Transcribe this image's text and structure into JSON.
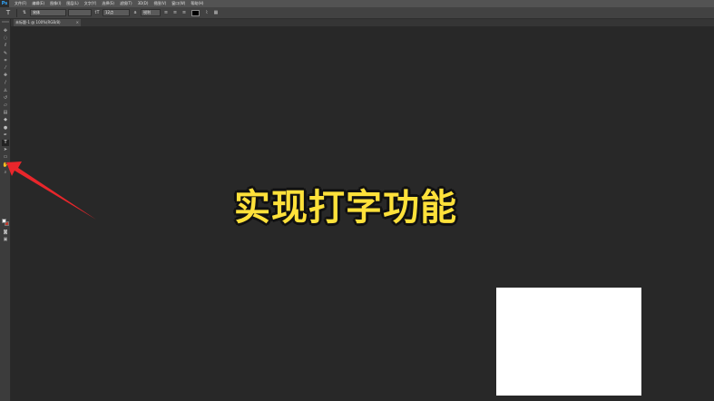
{
  "app": {
    "logo": "Ps"
  },
  "menu": [
    "文件(F)",
    "编辑(E)",
    "图像(I)",
    "图层(L)",
    "文字(Y)",
    "选择(S)",
    "滤镜(T)",
    "3D(D)",
    "视图(V)",
    "窗口(W)",
    "帮助(H)"
  ],
  "options": {
    "tool_glyph": "T",
    "font_family": "宋体",
    "font_size": "12点",
    "antialias": "锐利",
    "text_color": "#000000"
  },
  "document": {
    "tab_title": "未标题-1 @ 100%(RGB/8)",
    "close_glyph": "×"
  },
  "tools": [
    {
      "name": "move-tool",
      "glyph": "✥"
    },
    {
      "name": "marquee-tool",
      "glyph": "◌"
    },
    {
      "name": "lasso-tool",
      "glyph": "ℓ"
    },
    {
      "name": "quick-select-tool",
      "glyph": "✎"
    },
    {
      "name": "crop-tool",
      "glyph": "⌗"
    },
    {
      "name": "eyedropper-tool",
      "glyph": "⁄"
    },
    {
      "name": "healing-tool",
      "glyph": "✚"
    },
    {
      "name": "brush-tool",
      "glyph": "∕"
    },
    {
      "name": "stamp-tool",
      "glyph": "♙"
    },
    {
      "name": "history-brush-tool",
      "glyph": "↺"
    },
    {
      "name": "eraser-tool",
      "glyph": "▱"
    },
    {
      "name": "gradient-tool",
      "glyph": "▤"
    },
    {
      "name": "blur-tool",
      "glyph": "◆"
    },
    {
      "name": "dodge-tool",
      "glyph": "●"
    },
    {
      "name": "pen-tool",
      "glyph": "✒"
    },
    {
      "name": "type-tool",
      "glyph": "T"
    },
    {
      "name": "path-select-tool",
      "glyph": "➤"
    },
    {
      "name": "shape-tool",
      "glyph": "▭"
    },
    {
      "name": "hand-tool",
      "glyph": "✋"
    },
    {
      "name": "zoom-tool",
      "glyph": "⌕"
    }
  ],
  "extra_tools": [
    {
      "name": "quick-mask-tool",
      "glyph": "◙"
    },
    {
      "name": "screen-mode-tool",
      "glyph": "▣"
    }
  ],
  "caption": "实现打字功能",
  "colors": {
    "caption": "#ffe13a",
    "arrow": "#e8262b",
    "foreground": "#ffffff",
    "background": "#c0392b"
  }
}
